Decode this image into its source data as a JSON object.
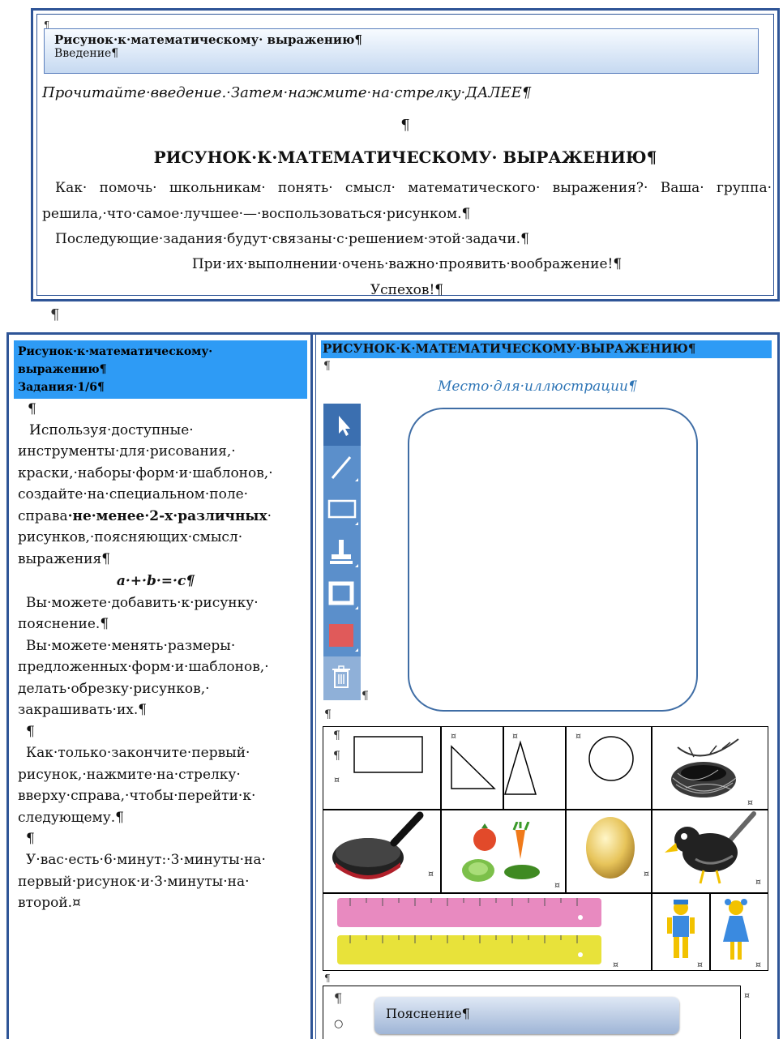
{
  "intro": {
    "banner_title": "Рисунок·к·математическому· выражению¶",
    "banner_subtitle": "Введение¶",
    "instruction": "Прочитайте·введение.·Затем·нажмите·на·стрелку·ДАЛЕЕ¶",
    "heading": "РИСУНОК·К·МАТЕМАТИЧЕСКОМУ· ВЫРАЖЕНИЮ¶",
    "para1_line1": "Как· помочь· школьникам· понять· смысл· математического· выражения?· Ваша· группа·",
    "para1_line2": "решила,·что·самое·лучшее·—·воспользоваться·рисунком.¶",
    "para2": "Последующие·задания·будут·связаны·с·решением·этой·задачи.¶",
    "para3": "При·их·выполнении·очень·важно·проявить·воображение!¶",
    "para4": "Успехов!¶"
  },
  "pilcrow": "¶",
  "left_panel": {
    "header_line1": "Рисунок·к·математическому·",
    "header_line2": "выражению¶",
    "header_line3": "Задания·1/6¶",
    "lines": [
      "Используя·доступные·",
      "инструменты·для·рисования,·",
      "краски,·наборы·форм·и·шаблонов,·",
      "создайте·на·специальном·поле·"
    ],
    "bold_prefix": "справа",
    "bold_text": "·не·менее·2-х·различных",
    "bold_suffix": "·",
    "lines2": [
      "рисунков,·поясняющих·смысл·",
      "выражения¶"
    ],
    "formula": "a·+·b·=·c¶",
    "lines3": [
      "Вы·можете·добавить·к·рисунку·",
      "пояснение.¶",
      "Вы·можете·менять·размеры·",
      "предложенных·форм·и·шаблонов,·",
      "делать·обрезку·рисунков,·",
      "закрашивать·их.¶"
    ],
    "lines4": [
      "Как·только·закончите·первый·",
      "рисунок,·нажмите·на·стрелку·",
      "вверху·справа,·чтобы·перейти·к·",
      "следующему.¶"
    ],
    "lines5": [
      "У·вас·есть·6·минут:·3·минуты·на·",
      "первый·рисунок·и·3·минуты·на·",
      "второй.¤"
    ]
  },
  "right_panel": {
    "header": "РИСУНОК·К·МАТЕМАТИЧЕСКОМУ·ВЫРАЖЕНИЮ¶",
    "illustration_label": "Место·для·иллюстрации¶",
    "explanation_button": "Пояснение¶",
    "cell_mark": "¤",
    "radio_mark": "○"
  },
  "toolbar": {
    "tools": [
      "cursor-icon",
      "line-icon",
      "rectangle-icon",
      "stamp-icon",
      "border-icon",
      "fill-color-icon",
      "trash-icon"
    ],
    "colors": {
      "bar": "#5b8fcb",
      "fill_swatch": "#e05a5a"
    }
  },
  "colors": {
    "accent": "#2e9bf5",
    "frame": "#2f5597",
    "label": "#2e75b6"
  }
}
